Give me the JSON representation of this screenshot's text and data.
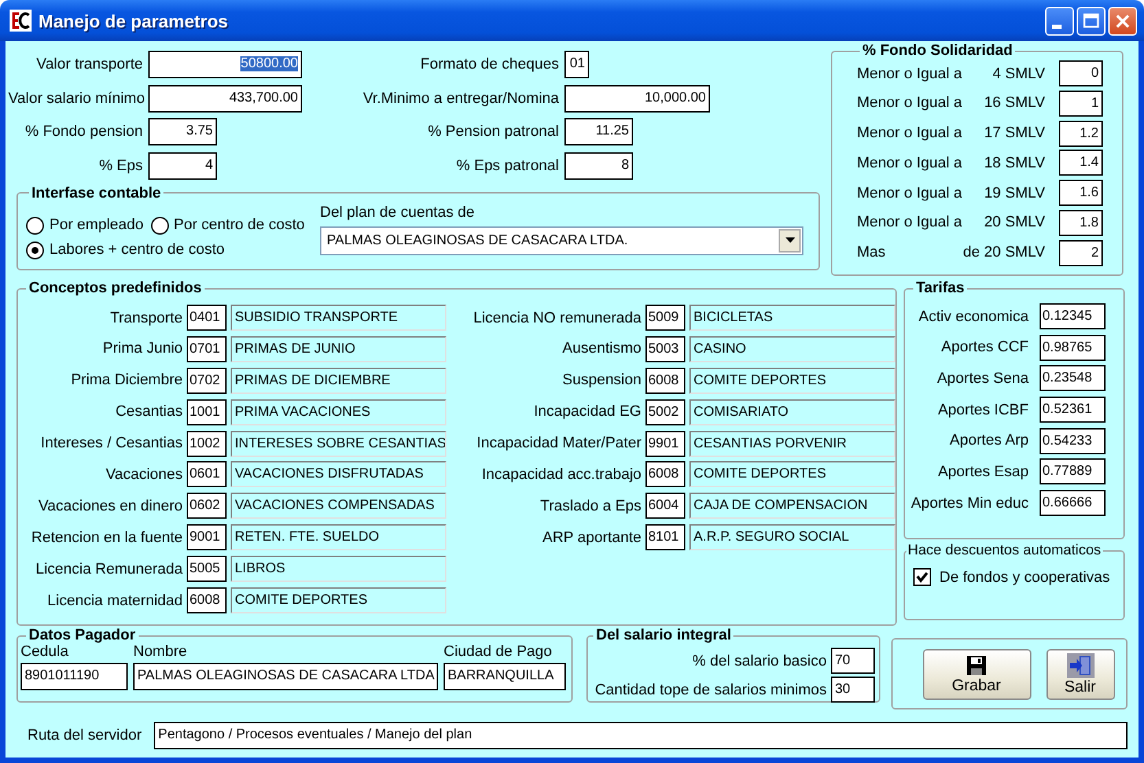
{
  "window": {
    "title": "Manejo de parametros"
  },
  "general_fields": [
    {
      "label": "Valor  transporte",
      "value": "50800.00",
      "selected": true
    },
    {
      "label": "Formato de cheques",
      "value": "01",
      "selected": false
    },
    {
      "label": "Valor salario mínimo",
      "value": "433,700.00",
      "selected": false
    },
    {
      "label": "Vr.Minimo a entregar/Nomina",
      "value": "10,000.00",
      "selected": false
    },
    {
      "label": "% Fondo pension",
      "value": "3.75",
      "selected": false
    },
    {
      "label": "% Pension patronal",
      "value": "11.25",
      "selected": false
    },
    {
      "label": "% Eps",
      "value": "4",
      "selected": false
    },
    {
      "label": "% Eps patronal",
      "value": "8",
      "selected": false
    }
  ],
  "interfase_contable": {
    "title": "Interfase contable",
    "options": [
      {
        "label": "Por empleado",
        "selected": false
      },
      {
        "label": "Por centro de costo",
        "selected": false
      },
      {
        "label": "Labores + centro de costo",
        "selected": true
      }
    ],
    "plan_label": "Del plan de cuentas de",
    "plan_value": "PALMAS OLEAGINOSAS DE CASACARA LTDA."
  },
  "fondo_solidaridad": {
    "title": "% Fondo Solidaridad",
    "rows": [
      {
        "label": "Menor o Igual a",
        "limit": "4 SMLV",
        "value": "0"
      },
      {
        "label": "Menor o Igual a",
        "limit": "16 SMLV",
        "value": "1"
      },
      {
        "label": "Menor o Igual a",
        "limit": "17 SMLV",
        "value": "1.2"
      },
      {
        "label": "Menor o Igual a",
        "limit": "18 SMLV",
        "value": "1.4"
      },
      {
        "label": "Menor o Igual a",
        "limit": "19 SMLV",
        "value": "1.6"
      },
      {
        "label": "Menor o Igual a",
        "limit": "20 SMLV",
        "value": "1.8"
      },
      {
        "label": "Mas",
        "limit": "de 20 SMLV",
        "value": "2"
      }
    ]
  },
  "conceptos": {
    "title": "Conceptos predefinidos",
    "left": [
      {
        "label": "Transporte",
        "code": "0401",
        "description": "SUBSIDIO TRANSPORTE"
      },
      {
        "label": "Prima Junio",
        "code": "0701",
        "description": "PRIMAS DE JUNIO"
      },
      {
        "label": "Prima Diciembre",
        "code": "0702",
        "description": "PRIMAS DE DICIEMBRE"
      },
      {
        "label": "Cesantias",
        "code": "1001",
        "description": "PRIMA VACACIONES"
      },
      {
        "label": "Intereses / Cesantias",
        "code": "1002",
        "description": "INTERESES SOBRE CESANTIAS"
      },
      {
        "label": "Vacaciones",
        "code": "0601",
        "description": "VACACIONES DISFRUTADAS"
      },
      {
        "label": "Vacaciones en dinero",
        "code": "0602",
        "description": "VACACIONES COMPENSADAS"
      },
      {
        "label": "Retencion en la fuente",
        "code": "9001",
        "description": "RETEN. FTE. SUELDO"
      },
      {
        "label": "Licencia Remunerada",
        "code": "5005",
        "description": "LIBROS"
      },
      {
        "label": "Licencia maternidad",
        "code": "6008",
        "description": "COMITE DEPORTES"
      }
    ],
    "right": [
      {
        "label": "Licencia NO remunerada",
        "code": "5009",
        "description": "BICICLETAS"
      },
      {
        "label": "Ausentismo",
        "code": "5003",
        "description": "CASINO"
      },
      {
        "label": "Suspension",
        "code": "6008",
        "description": "COMITE DEPORTES"
      },
      {
        "label": "Incapacidad EG",
        "code": "5002",
        "description": "COMISARIATO"
      },
      {
        "label": "Incapacidad Mater/Pater",
        "code": "9901",
        "description": "CESANTIAS PORVENIR"
      },
      {
        "label": "Incapacidad acc.trabajo",
        "code": "6008",
        "description": "COMITE DEPORTES"
      },
      {
        "label": "Traslado a Eps",
        "code": "6004",
        "description": "CAJA DE COMPENSACION"
      },
      {
        "label": "ARP aportante",
        "code": "8101",
        "description": "A.R.P. SEGURO SOCIAL"
      }
    ]
  },
  "tarifas": {
    "title": "Tarifas",
    "rows": [
      {
        "label": "Activ economica",
        "value": "0.12345"
      },
      {
        "label": "Aportes CCF",
        "value": "0.98765"
      },
      {
        "label": "Aportes Sena",
        "value": "0.23548"
      },
      {
        "label": "Aportes ICBF",
        "value": "0.52361"
      },
      {
        "label": "Aportes Arp",
        "value": "0.54233"
      },
      {
        "label": "Aportes Esap",
        "value": "0.77889"
      },
      {
        "label": "Aportes Min educ",
        "value": "0.66666"
      }
    ]
  },
  "descuentos": {
    "title": "Hace descuentos automaticos",
    "checkbox": {
      "label": "De fondos y cooperativas",
      "checked": true
    }
  },
  "datos_pagador": {
    "title": "Datos Pagador",
    "columns": [
      "Cedula",
      "Nombre",
      "Ciudad de Pago"
    ],
    "values": [
      "8901011190",
      "PALMAS OLEAGINOSAS DE CASACARA LTDA",
      "BARRANQUILLA"
    ]
  },
  "salario_integral": {
    "title": "Del salario integral",
    "rows": [
      {
        "label": "% del salario basico",
        "value": "70"
      },
      {
        "label": "Cantidad tope de salarios minimos",
        "value": "30"
      }
    ]
  },
  "buttons": [
    {
      "label": "Grabar",
      "kind": "save"
    },
    {
      "label": "Salir",
      "kind": "exit"
    }
  ],
  "ruta": {
    "label": "Ruta del servidor",
    "value": "Pentagono / Procesos eventuales / Manejo del plan"
  }
}
